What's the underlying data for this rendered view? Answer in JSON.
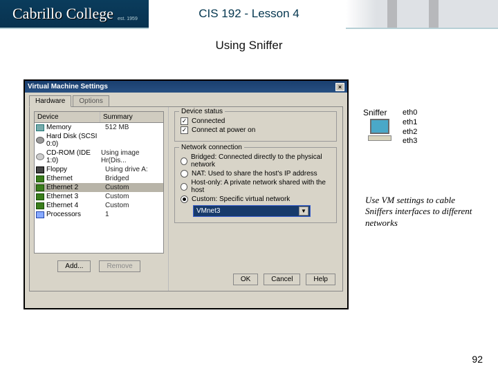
{
  "header": {
    "logo_text": "Cabrillo College",
    "logo_sub": "est. 1959",
    "course_title": "CIS 192 - Lesson 4"
  },
  "section_title": "Using Sniffer",
  "dialog": {
    "title": "Virtual Machine Settings",
    "close_glyph": "×",
    "tabs": {
      "hardware": "Hardware",
      "options": "Options"
    },
    "columns": {
      "device": "Device",
      "summary": "Summary"
    },
    "devices": [
      {
        "name": "Memory",
        "summary": "512 MB"
      },
      {
        "name": "Hard Disk (SCSI 0:0)",
        "summary": ""
      },
      {
        "name": "CD-ROM (IDE 1:0)",
        "summary": "Using image Hr(Dis..."
      },
      {
        "name": "Floppy",
        "summary": "Using drive A:"
      },
      {
        "name": "Ethernet",
        "summary": "Bridged"
      },
      {
        "name": "Ethernet 2",
        "summary": "Custom"
      },
      {
        "name": "Ethernet 3",
        "summary": "Custom"
      },
      {
        "name": "Ethernet 4",
        "summary": "Custom"
      },
      {
        "name": "Processors",
        "summary": "1"
      }
    ],
    "selected_device_index": 5,
    "left_buttons": {
      "add": "Add...",
      "remove": "Remove"
    },
    "device_status": {
      "group_title": "Device status",
      "connected": {
        "label": "Connected",
        "checked": true
      },
      "connect_at_power_on": {
        "label": "Connect at power on",
        "checked": true
      }
    },
    "network_connection": {
      "group_title": "Network connection",
      "options": [
        {
          "label": "Bridged: Connected directly to the physical network",
          "selected": false
        },
        {
          "label": "NAT: Used to share the host's IP address",
          "selected": false
        },
        {
          "label": "Host-only: A private network shared with the host",
          "selected": false
        },
        {
          "label": "Custom: Specific virtual network",
          "selected": true
        }
      ],
      "combo_value": "VMnet3"
    },
    "footer": {
      "ok": "OK",
      "cancel": "Cancel",
      "help": "Help"
    }
  },
  "annotations": {
    "sniffer_label": "Sniffer",
    "eth_list": [
      "eth0",
      "eth1",
      "eth2",
      "eth3"
    ],
    "note": "Use VM settings to cable Sniffers interfaces to different networks"
  },
  "page_number": "92"
}
